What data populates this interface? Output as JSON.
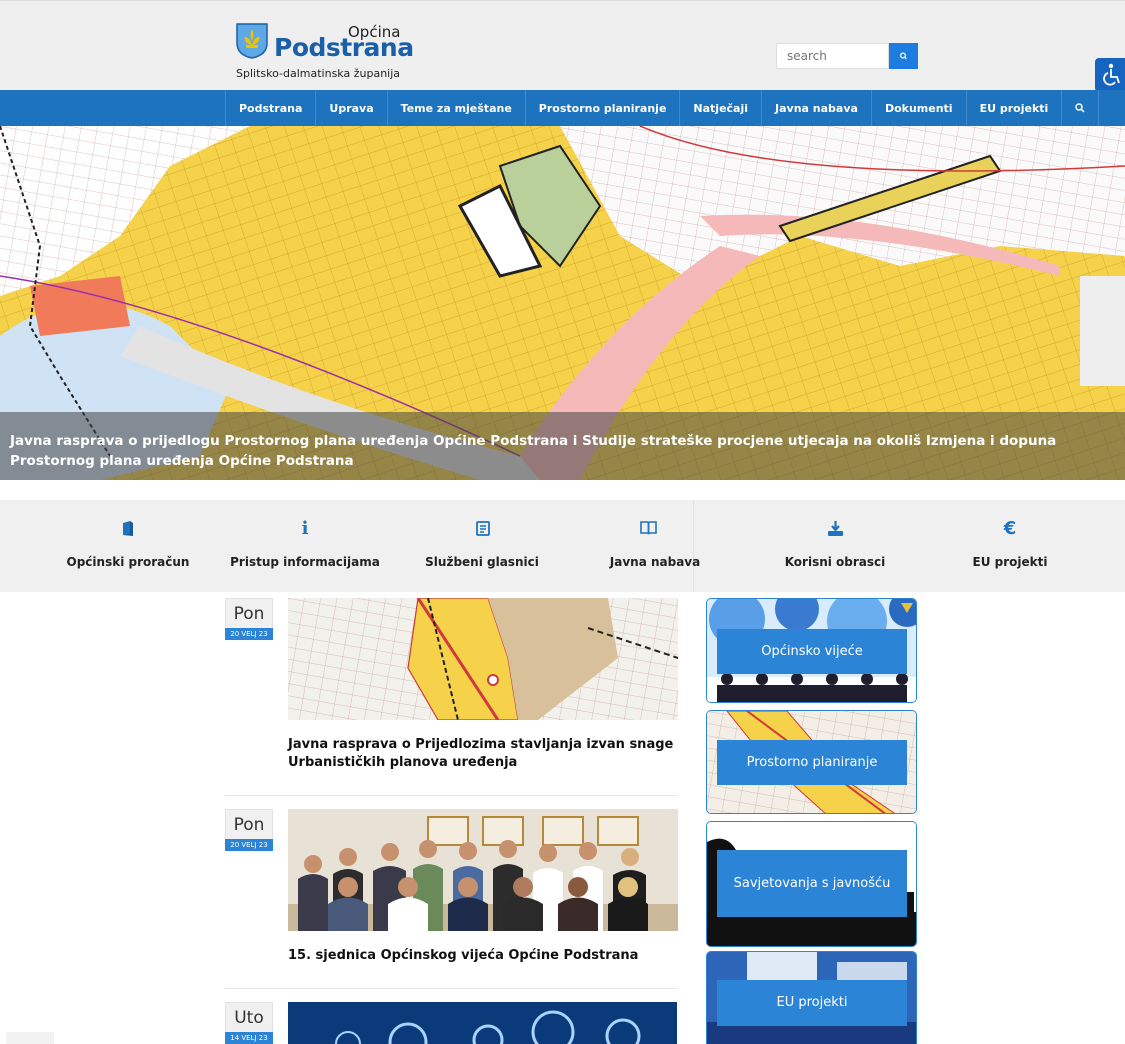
{
  "header": {
    "logo_small": "Općina",
    "logo_big": "Podstrana",
    "logo_sub": "Splitsko-dalmatinska županija",
    "search_placeholder": "search"
  },
  "nav": {
    "items": [
      "Podstrana",
      "Uprava",
      "Teme za mještane",
      "Prostorno planiranje",
      "Natječaji",
      "Javna nabava",
      "Dokumenti",
      "EU projekti"
    ]
  },
  "hero": {
    "caption": "Javna rasprava o prijedlogu Prostornog plana uređenja Općine Podstrana i Studije strateške procjene utjecaja na okoliš Izmjena i dopuna Prostornog plana uređenja Općine Podstrana"
  },
  "quick_links": [
    {
      "label": "Općinski proračun",
      "icon": "book-icon"
    },
    {
      "label": "Pristup informacijama",
      "icon": "info-icon"
    },
    {
      "label": "Službeni glasnici",
      "icon": "news-icon"
    },
    {
      "label": "Javna nabava",
      "icon": "open-book-icon"
    },
    {
      "label": "Korisni obrasci",
      "icon": "download-icon"
    },
    {
      "label": "EU projekti",
      "icon": "euro-icon"
    }
  ],
  "news": [
    {
      "day": "Pon",
      "date": "20 VELJ 23",
      "title": "Javna rasprava o Prijedlozima stavljanja izvan snage Urbanističkih planova uređenja"
    },
    {
      "day": "Pon",
      "date": "20 VELJ 23",
      "title": "15. sjednica Općinskog vijeća Općine Podstrana"
    },
    {
      "day": "Uto",
      "date": "14 VELJ 23",
      "title": ""
    }
  ],
  "sidebar": [
    {
      "label": "Općinsko vijeće"
    },
    {
      "label": "Prostorno planiranje"
    },
    {
      "label": "Savjetovanja s javnošću"
    },
    {
      "label": "EU projekti"
    }
  ],
  "colors": {
    "brand_blue": "#1e73be",
    "button_blue": "#2b84d6",
    "header_bg": "#efefef"
  }
}
